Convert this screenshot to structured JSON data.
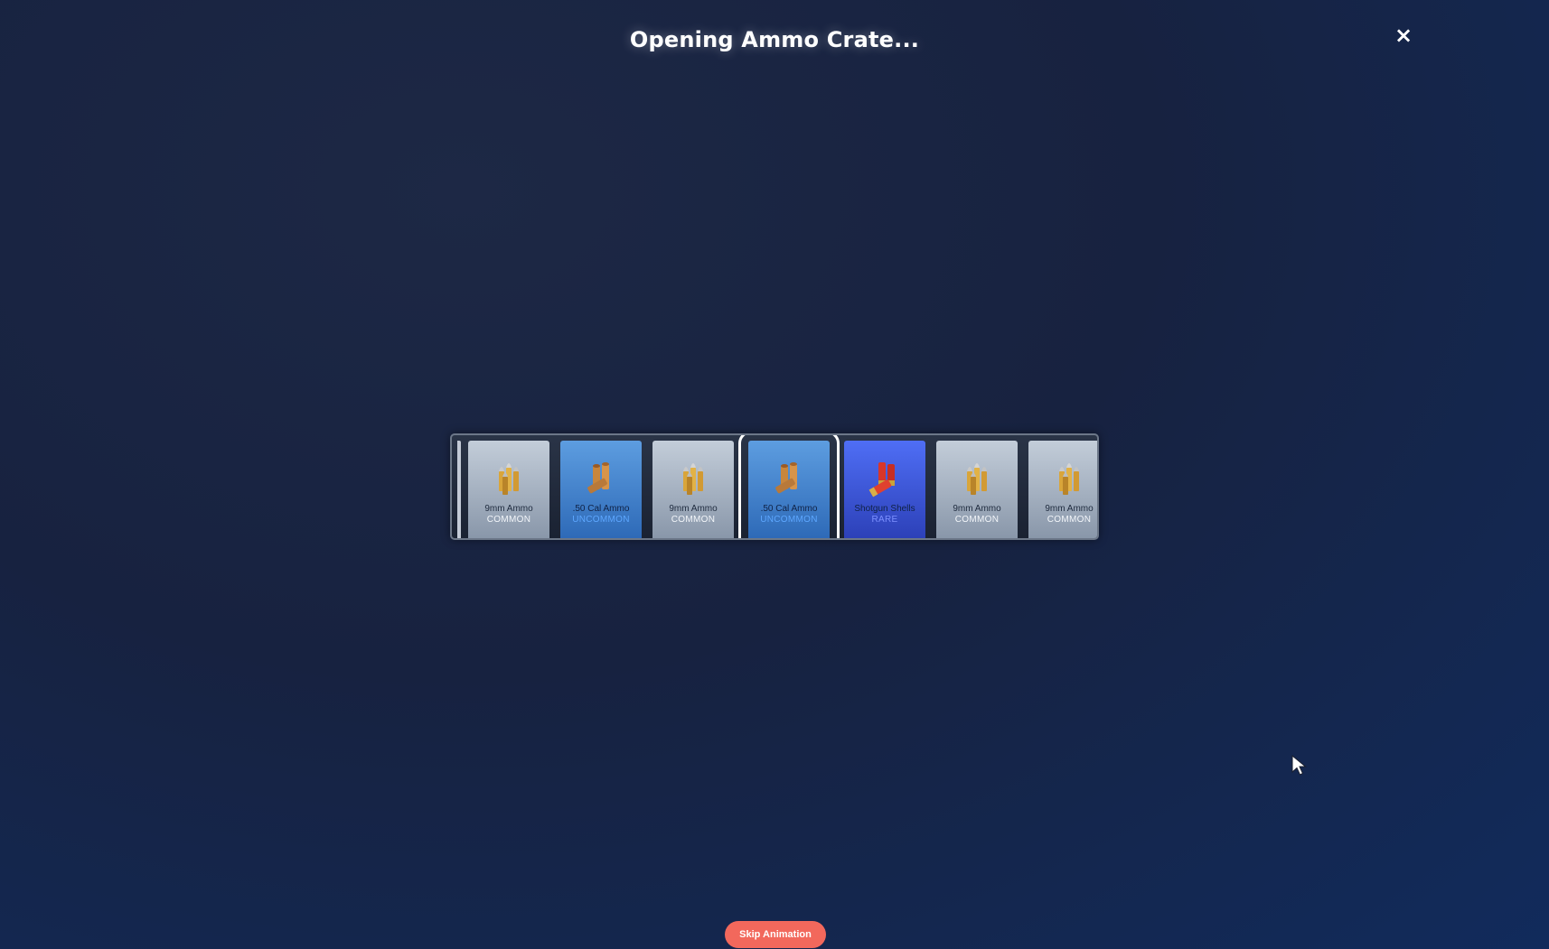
{
  "header": {
    "title": "Opening Ammo Crate...",
    "close_icon": "×"
  },
  "reel": {
    "items": [
      {
        "name": "9mm Ammo",
        "rarity": "COMMON",
        "icon": "brass-bullets-icon"
      },
      {
        "name": ".50 Cal Ammo",
        "rarity": "UNCOMMON",
        "icon": "large-casings-icon"
      },
      {
        "name": "9mm Ammo",
        "rarity": "COMMON",
        "icon": "brass-bullets-icon"
      },
      {
        "name": ".50 Cal Ammo",
        "rarity": "UNCOMMON",
        "icon": "large-casings-icon",
        "selected": true
      },
      {
        "name": "Shotgun Shells",
        "rarity": "RARE",
        "icon": "shotgun-shells-icon"
      },
      {
        "name": "9mm Ammo",
        "rarity": "COMMON",
        "icon": "brass-bullets-icon"
      },
      {
        "name": "9mm Ammo",
        "rarity": "COMMON",
        "icon": "brass-bullets-icon"
      }
    ]
  },
  "footer": {
    "skip_label": "Skip Animation"
  },
  "colors": {
    "common": "#c3cdd9",
    "uncommon": "#3f85d4",
    "rare": "#3d57e0",
    "skip_button": "#f2685c"
  }
}
